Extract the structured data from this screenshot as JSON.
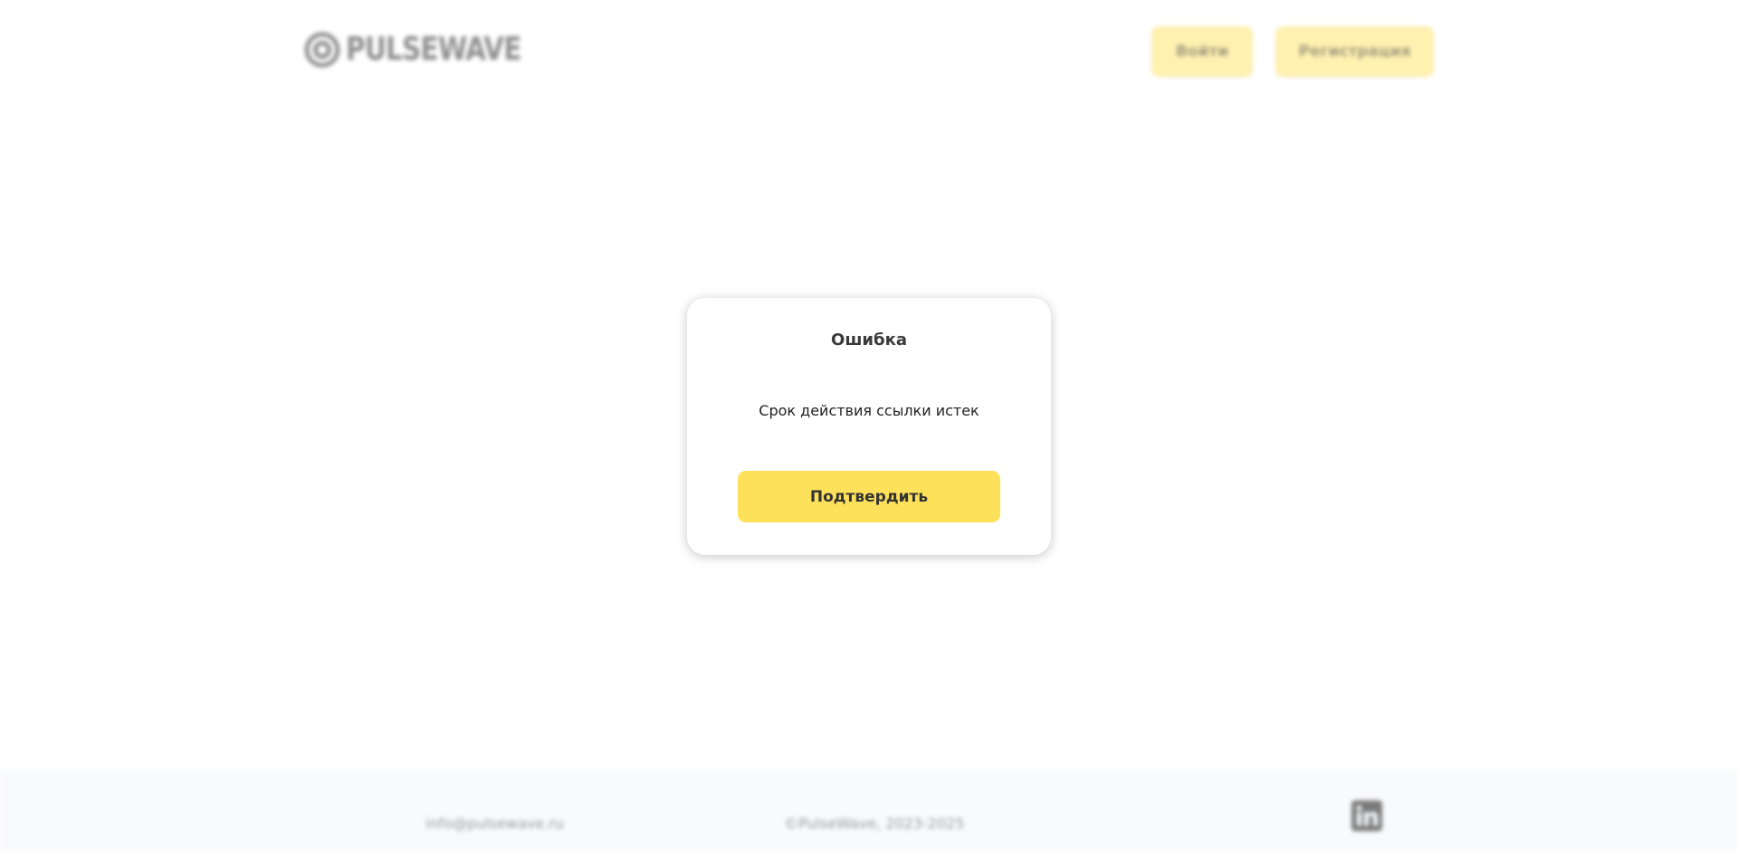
{
  "header": {
    "logo_text": "PULSEWAVE",
    "login_label": "Войти",
    "register_label": "Регистрация"
  },
  "modal": {
    "title": "Ошибка",
    "message": "Срок действия ссылки истек",
    "confirm_label": "Подтвердить"
  },
  "footer": {
    "email": "info@pulsewave.ru",
    "copyright": "©PulseWave, 2023-2025",
    "social_icon": "linkedin-icon"
  },
  "colors": {
    "accent": "#fde15a",
    "accent_dimmed": "#fff1b0",
    "footer_bg": "#f9fafc"
  }
}
